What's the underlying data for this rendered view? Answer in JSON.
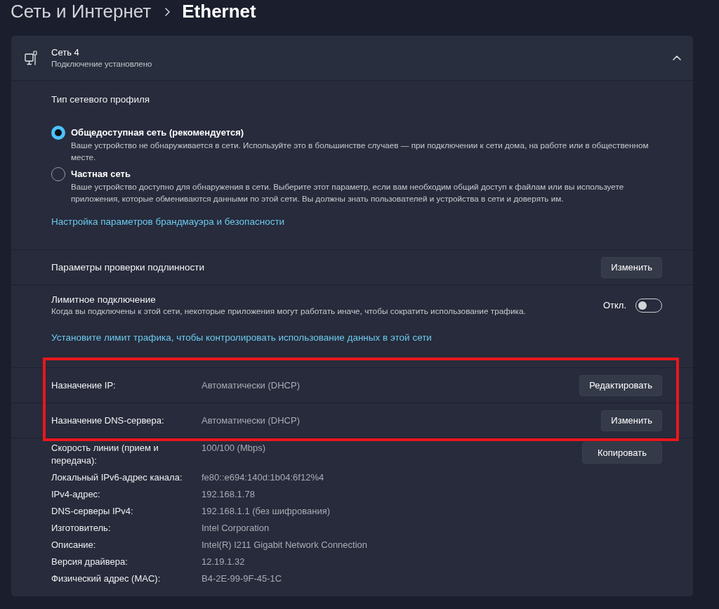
{
  "breadcrumb": {
    "parent": "Сеть и Интернет",
    "current": "Ethernet"
  },
  "network": {
    "name": "Сеть 4",
    "status": "Подключение установлено",
    "expanded": true
  },
  "profile": {
    "heading": "Тип сетевого профиля",
    "options": [
      {
        "label": "Общедоступная сеть (рекомендуется)",
        "description": "Ваше устройство не обнаруживается в сети. Используйте это в большинстве случаев — при подключении к сети дома, на работе или в общественном месте.",
        "selected": true
      },
      {
        "label": "Частная сеть",
        "description": "Ваше устройство доступно для обнаружения в сети. Выберите этот параметр, если вам необходим общий доступ к файлам или вы используете приложения, которые обмениваются данными по этой сети. Вы должны знать пользователей и устройства в сети и доверять им.",
        "selected": false
      }
    ],
    "link": "Настройка параметров брандмауэра и безопасности"
  },
  "settings": [
    {
      "kind": "button",
      "label": "Параметры проверки подлинности",
      "button": "Изменить"
    },
    {
      "kind": "toggle",
      "label": "Лимитное подключение",
      "description": "Когда вы подключены к этой сети, некоторые приложения могут работать иначе, чтобы сократить использование трафика.",
      "state_text": "Откл.",
      "on": false,
      "link": "Установите лимит трафика, чтобы контролировать использование данных в этой сети"
    }
  ],
  "ip_settings": {
    "highlighted": true,
    "rows": [
      {
        "label": "Назначение IP:",
        "value": "Автоматически (DHCP)",
        "button": "Редактировать"
      },
      {
        "label": "Назначение DNS-сервера:",
        "value": "Автоматически (DHCP)",
        "button": "Изменить"
      }
    ]
  },
  "properties": {
    "button": "Копировать",
    "rows": [
      {
        "label": "Скорость линии (прием и передача):",
        "value": "100/100 (Mbps)"
      },
      {
        "label": "Локальный IPv6-адрес канала:",
        "value": "fe80::e694:140d:1b04:6f12%4"
      },
      {
        "label": "IPv4-адрес:",
        "value": "192.168.1.78"
      },
      {
        "label": "DNS-серверы IPv4:",
        "value": "192.168.1.1 (без шифрования)"
      },
      {
        "label": "Изготовитель:",
        "value": "Intel Corporation"
      },
      {
        "label": "Описание:",
        "value": "Intel(R) I211 Gigabit Network Connection"
      },
      {
        "label": "Версия драйвера:",
        "value": "12.19.1.32"
      },
      {
        "label": "Физический адрес (MAC):",
        "value": "B4-2E-99-9F-45-1C"
      }
    ]
  }
}
